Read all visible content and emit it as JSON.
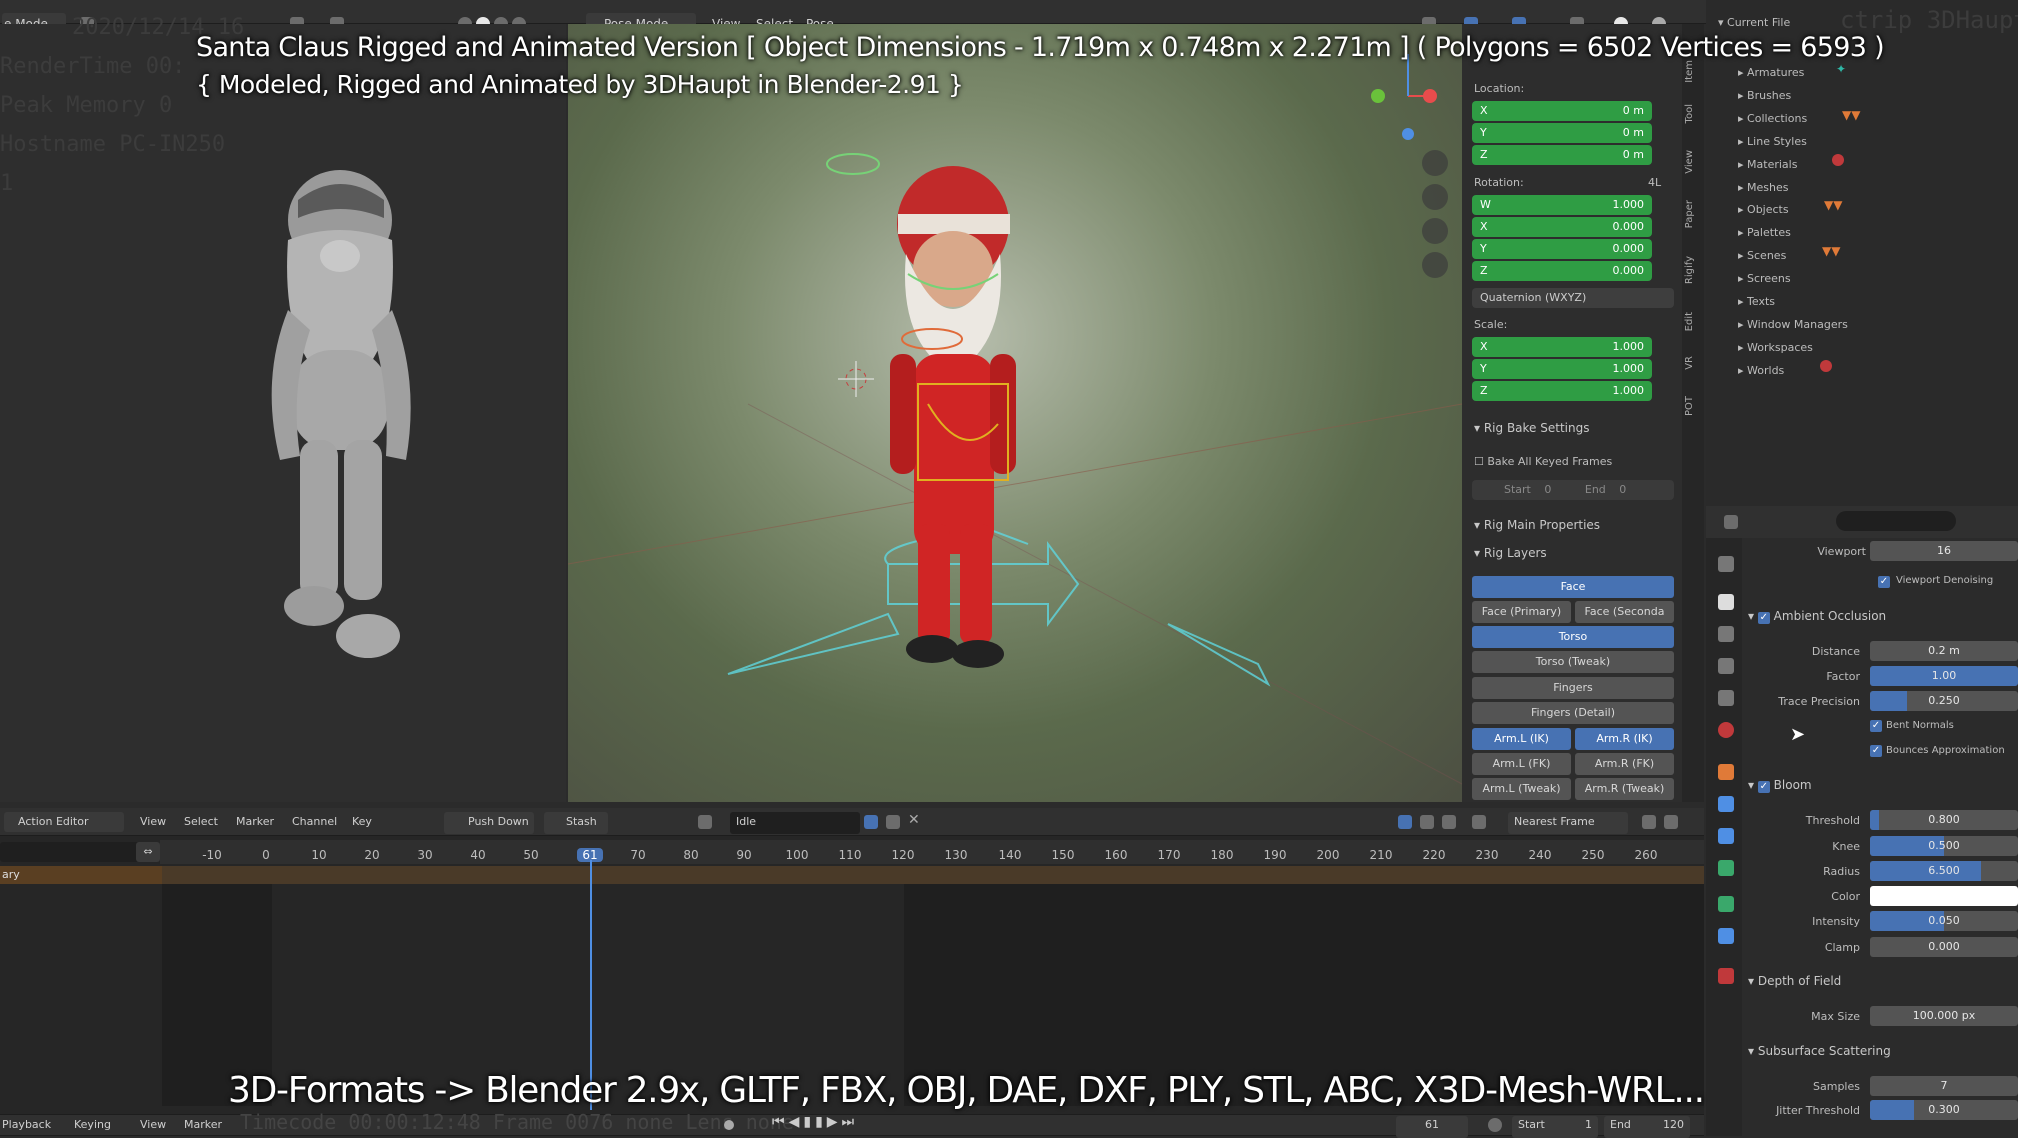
{
  "top_left_mode": "e Mode",
  "viewport_header": {
    "mode": "Pose Mode",
    "menu": [
      "View",
      "Select",
      "Pose"
    ]
  },
  "stats_ghost": [
    "2020/12/14 16",
    "RenderTime 00:",
    "Peak Memory 0",
    "Hostname PC-IN250",
    "1"
  ],
  "captions": {
    "title_line1": "Santa Claus Rigged and Animated Version [ Object Dimensions -  1.719m x 0.748m x 2.271m ] ( Polygons = 6502  Vertices = 6593 )",
    "title_line2": "{ Modeled, Rigged and Animated by 3DHaupt in Blender-2.91 }",
    "formats": "3D-Formats -> Blender 2.9x, GLTF, FBX, OBJ, DAE, DXF, PLY, STL, ABC, X3D-Mesh-WRL..."
  },
  "n_panel": {
    "location_label": "Location:",
    "location": [
      {
        "k": "X",
        "v": "0 m"
      },
      {
        "k": "Y",
        "v": "0 m"
      },
      {
        "k": "Z",
        "v": "0 m"
      }
    ],
    "rotation_label": "Rotation:",
    "rotation_mode_tag": "4L",
    "rotation": [
      {
        "k": "W",
        "v": "1.000"
      },
      {
        "k": "X",
        "v": "0.000"
      },
      {
        "k": "Y",
        "v": "0.000"
      },
      {
        "k": "Z",
        "v": "0.000"
      }
    ],
    "rotation_mode": "Quaternion (WXYZ)",
    "scale_label": "Scale:",
    "scale": [
      {
        "k": "X",
        "v": "1.000"
      },
      {
        "k": "Y",
        "v": "1.000"
      },
      {
        "k": "Z",
        "v": "1.000"
      }
    ],
    "rig_bake": "Rig Bake Settings",
    "bake_all": "Bake All Keyed Frames",
    "bake_start": "Start",
    "bake_start_v": "0",
    "bake_end": "End",
    "bake_end_v": "0",
    "rig_main": "Rig Main Properties",
    "rig_layers": "Rig Layers",
    "layers": {
      "face": "Face",
      "face_primary": "Face (Primary)",
      "face_secondary": "Face (Seconda",
      "torso": "Torso",
      "torso_tweak": "Torso (Tweak)",
      "fingers": "Fingers",
      "fingers_detail": "Fingers (Detail)",
      "arm_l_ik": "Arm.L (IK)",
      "arm_r_ik": "Arm.R (IK)",
      "arm_l_fk": "Arm.L (FK)",
      "arm_r_fk": "Arm.R (FK)",
      "arm_l_tweak": "Arm.L (Tweak)",
      "arm_r_tweak": "Arm.R (Tweak)"
    },
    "tabs": [
      "Item",
      "Tool",
      "View",
      "Paper",
      "Rigify",
      "Edit",
      "VR",
      "POT"
    ]
  },
  "outliner": {
    "root": "Current File",
    "ghost_tail": "ctrip 3DHaupt",
    "items": [
      "Armatures",
      "Brushes",
      "Collections",
      "Line Styles",
      "Materials",
      "Meshes",
      "Objects",
      "Palettes",
      "Scenes",
      "Screens",
      "Texts",
      "Window Managers",
      "Workspaces",
      "Worlds"
    ]
  },
  "properties": {
    "viewport_label": "Viewport",
    "viewport_value": "16",
    "viewport_denoising": "Viewport Denoising",
    "ao": "Ambient Occlusion",
    "distance_l": "Distance",
    "distance_v": "0.2 m",
    "factor_l": "Factor",
    "factor_v": "1.00",
    "factor_fill": 1.0,
    "trace_l": "Trace Precision",
    "trace_v": "0.250",
    "trace_fill": 0.25,
    "bent_normals": "Bent Normals",
    "bounces": "Bounces Approximation",
    "bloom": "Bloom",
    "threshold_l": "Threshold",
    "threshold_v": "0.800",
    "threshold_fill": 0.06,
    "knee_l": "Knee",
    "knee_v": "0.500",
    "knee_fill": 0.5,
    "radius_l": "Radius",
    "radius_v": "6.500",
    "radius_fill": 0.75,
    "color_l": "Color",
    "intensity_l": "Intensity",
    "intensity_v": "0.050",
    "intensity_fill": 0.5,
    "clamp_l": "Clamp",
    "clamp_v": "0.000",
    "clamp_fill": 0.0,
    "dof": "Depth of Field",
    "maxsize_l": "Max Size",
    "maxsize_v": "100.000 px",
    "sss": "Subsurface Scattering",
    "samples_l": "Samples",
    "samples_v": "7",
    "jitter_l": "Jitter Threshold",
    "jitter_v": "0.300",
    "jitter_fill": 0.3
  },
  "action_editor": {
    "mode": "Action Editor",
    "menu": [
      "View",
      "Select",
      "Marker",
      "Channel",
      "Key"
    ],
    "push_down": "Push Down",
    "stash": "Stash",
    "action_name": "Idle",
    "snap": "Nearest Frame",
    "ticks": [
      "-10",
      "0",
      "10",
      "20",
      "30",
      "40",
      "50",
      "61",
      "70",
      "80",
      "90",
      "100",
      "110",
      "120",
      "130",
      "140",
      "150",
      "160",
      "170",
      "180",
      "190",
      "200",
      "210",
      "220",
      "230",
      "240",
      "250",
      "260"
    ],
    "current_frame": "61",
    "channel": "ary"
  },
  "footer": {
    "menu": [
      "Playback",
      "Keying",
      "View",
      "Marker"
    ],
    "ghost": "Timecode 00:00:12:48   Frame 0076   none   Lens none",
    "frame": "61",
    "start_l": "Start",
    "start_v": "1",
    "end_l": "End",
    "end_v": "120"
  }
}
